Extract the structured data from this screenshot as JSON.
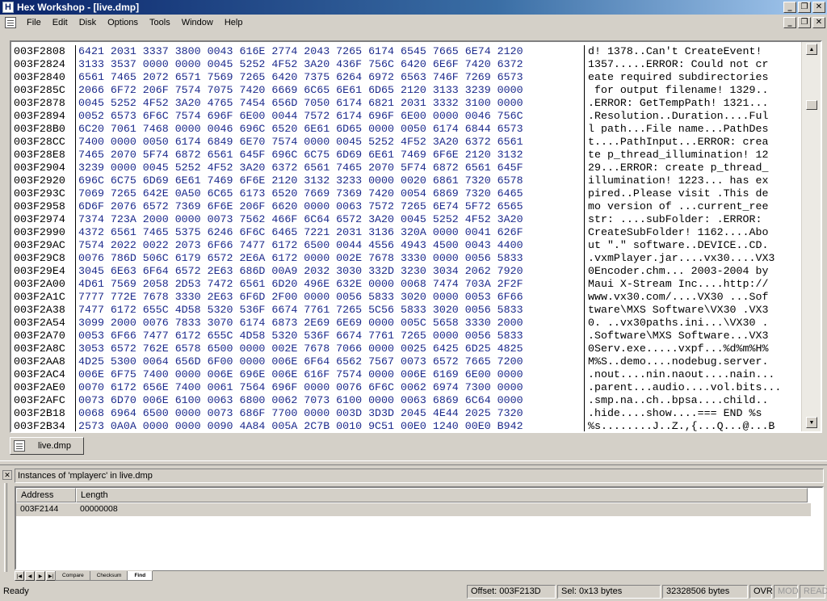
{
  "window": {
    "app_icon_letter": "H",
    "title": "Hex Workshop - [live.dmp]"
  },
  "menu": [
    "File",
    "Edit",
    "Disk",
    "Options",
    "Tools",
    "Window",
    "Help"
  ],
  "hex_rows": [
    {
      "addr": "003F2808",
      "hex": "6421 2031 3337 3800 0043 616E 2774 2043 7265 6174 6545 7665 6E74 2120",
      "ascii": "d! 1378..Can't CreateEvent! "
    },
    {
      "addr": "003F2824",
      "hex": "3133 3537 0000 0000 0045 5252 4F52 3A20 436F 756C 6420 6E6F 7420 6372",
      "ascii": "1357.....ERROR: Could not cr"
    },
    {
      "addr": "003F2840",
      "hex": "6561 7465 2072 6571 7569 7265 6420 7375 6264 6972 6563 746F 7269 6573",
      "ascii": "eate required subdirectories"
    },
    {
      "addr": "003F285C",
      "hex": "2066 6F72 206F 7574 7075 7420 6669 6C65 6E61 6D65 2120 3133 3239 0000",
      "ascii": " for output filename! 1329.."
    },
    {
      "addr": "003F2878",
      "hex": "0045 5252 4F52 3A20 4765 7454 656D 7050 6174 6821 2031 3332 3100 0000",
      "ascii": ".ERROR: GetTempPath! 1321..."
    },
    {
      "addr": "003F2894",
      "hex": "0052 6573 6F6C 7574 696F 6E00 0044 7572 6174 696F 6E00 0000 0046 756C",
      "ascii": ".Resolution..Duration....Ful"
    },
    {
      "addr": "003F28B0",
      "hex": "6C20 7061 7468 0000 0046 696C 6520 6E61 6D65 0000 0050 6174 6844 6573",
      "ascii": "l path...File name...PathDes"
    },
    {
      "addr": "003F28CC",
      "hex": "7400 0000 0050 6174 6849 6E70 7574 0000 0045 5252 4F52 3A20 6372 6561",
      "ascii": "t....PathInput...ERROR: crea"
    },
    {
      "addr": "003F28E8",
      "hex": "7465 2070 5F74 6872 6561 645F 696C 6C75 6D69 6E61 7469 6F6E 2120 3132",
      "ascii": "te p_thread_illumination! 12"
    },
    {
      "addr": "003F2904",
      "hex": "3239 0000 0045 5252 4F52 3A20 6372 6561 7465 2070 5F74 6872 6561 645F",
      "ascii": "29...ERROR: create p_thread_"
    },
    {
      "addr": "003F2920",
      "hex": "696C 6C75 6D69 6E61 7469 6F6E 2120 3132 3233 0000 0020 6861 7320 6578",
      "ascii": "illumination! 1223... has ex"
    },
    {
      "addr": "003F293C",
      "hex": "7069 7265 642E 0A50 6C65 6173 6520 7669 7369 7420 0054 6869 7320 6465",
      "ascii": "pired..Please visit .This de"
    },
    {
      "addr": "003F2958",
      "hex": "6D6F 2076 6572 7369 6F6E 206F 6620 0000 0063 7572 7265 6E74 5F72 6565",
      "ascii": "mo version of ...current_ree"
    },
    {
      "addr": "003F2974",
      "hex": "7374 723A 2000 0000 0073 7562 466F 6C64 6572 3A20 0045 5252 4F52 3A20",
      "ascii": "str: ....subFolder: .ERROR: "
    },
    {
      "addr": "003F2990",
      "hex": "4372 6561 7465 5375 6246 6F6C 6465 7221 2031 3136 320A 0000 0041 626F",
      "ascii": "CreateSubFolder! 1162....Abo"
    },
    {
      "addr": "003F29AC",
      "hex": "7574 2022 0022 2073 6F66 7477 6172 6500 0044 4556 4943 4500 0043 4400",
      "ascii": "ut \".\" software..DEVICE..CD."
    },
    {
      "addr": "003F29C8",
      "hex": "0076 786D 506C 6179 6572 2E6A 6172 0000 002E 7678 3330 0000 0056 5833",
      "ascii": ".vxmPlayer.jar....vx30....VX3"
    },
    {
      "addr": "003F29E4",
      "hex": "3045 6E63 6F64 6572 2E63 686D 00A9 2032 3030 332D 3230 3034 2062 7920",
      "ascii": "0Encoder.chm... 2003-2004 by"
    },
    {
      "addr": "003F2A00",
      "hex": "4D61 7569 2058 2D53 7472 6561 6D20 496E 632E 0000 0068 7474 703A 2F2F",
      "ascii": "Maui X-Stream Inc....http://"
    },
    {
      "addr": "003F2A1C",
      "hex": "7777 772E 7678 3330 2E63 6F6D 2F00 0000 0056 5833 3020 0000 0053 6F66",
      "ascii": "www.vx30.com/....VX30 ...Sof"
    },
    {
      "addr": "003F2A38",
      "hex": "7477 6172 655C 4D58 5320 536F 6674 7761 7265 5C56 5833 3020 0056 5833",
      "ascii": "tware\\MXS Software\\VX30 .VX3"
    },
    {
      "addr": "003F2A54",
      "hex": "3099 2000 0076 7833 3070 6174 6873 2E69 6E69 0000 005C 5658 3330 2000",
      "ascii": "0. ..vx30paths.ini...\\VX30 ."
    },
    {
      "addr": "003F2A70",
      "hex": "0053 6F66 7477 6172 655C 4D58 5320 536F 6674 7761 7265 0000 0056 5833",
      "ascii": ".Software\\MXS Software...VX3"
    },
    {
      "addr": "003F2A8C",
      "hex": "3053 6572 762E 6578 6500 0000 002E 7678 7066 0000 0025 6425 6D25 4825",
      "ascii": "0Serv.exe.....vxpf...%d%m%H%"
    },
    {
      "addr": "003F2AA8",
      "hex": "4D25 5300 0064 656D 6F00 0000 006E 6F64 6562 7567 0073 6572 7665 7200",
      "ascii": "M%S..demo....nodebug.server."
    },
    {
      "addr": "003F2AC4",
      "hex": "006E 6F75 7400 0000 006E 696E 006E 616F 7574 0000 006E 6169 6E00 0000",
      "ascii": ".nout....nin.naout....nain..."
    },
    {
      "addr": "003F2AE0",
      "hex": "0070 6172 656E 7400 0061 7564 696F 0000 0076 6F6C 0062 6974 7300 0000",
      "ascii": ".parent...audio....vol.bits..."
    },
    {
      "addr": "003F2AFC",
      "hex": "0073 6D70 006E 6100 0063 6800 0062 7073 6100 0000 0063 6869 6C64 0000",
      "ascii": ".smp.na..ch..bpsa....child.."
    },
    {
      "addr": "003F2B18",
      "hex": "0068 6964 6500 0000 0073 686F 7700 0000 003D 3D3D 2045 4E44 2025 7320",
      "ascii": ".hide....show....=== END %s "
    },
    {
      "addr": "003F2B34",
      "hex": "2573 0A0A 0000 0000 0090 4A84 005A 2C7B 0010 9C51 00E0 1240 00E0 B942",
      "ascii": "%s........J..Z.,{...Q...@...B"
    }
  ],
  "doc_tab": "live.dmp",
  "results": {
    "instances_label": "Instances of 'mplayerc' in live.dmp",
    "columns": [
      "Address",
      "Length"
    ],
    "rows": [
      {
        "address": "003F2144",
        "length": "00000008"
      }
    ],
    "tabs": [
      "Compare",
      "Checksum",
      "Find"
    ],
    "active_tab": "Find"
  },
  "status": {
    "ready": "Ready",
    "offset": "Offset: 003F213D",
    "sel": "Sel: 0x13 bytes",
    "size": "32328506 bytes",
    "ovr": "OVR",
    "mod": "MOD",
    "read": "READ"
  }
}
